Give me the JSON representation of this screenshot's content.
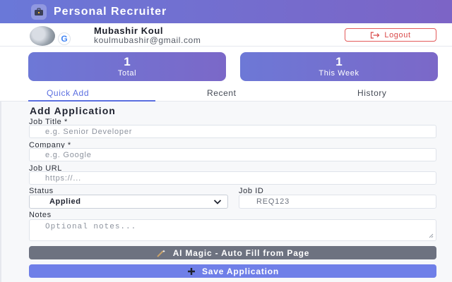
{
  "header": {
    "title": "Personal Recruiter",
    "logo_icon": "briefcase-icon"
  },
  "user": {
    "name": "Mubashir Koul",
    "email": "koulmubashir@gmail.com",
    "logout_label": "Logout"
  },
  "stats": [
    {
      "value": "1",
      "label": "Total"
    },
    {
      "value": "1",
      "label": "This Week"
    }
  ],
  "tabs": [
    {
      "label": "Quick Add",
      "active": true
    },
    {
      "label": "Recent",
      "active": false
    },
    {
      "label": "History",
      "active": false
    }
  ],
  "form": {
    "title": "Add Application",
    "job_title": {
      "label": "Job Title *",
      "placeholder": "e.g. Senior Developer"
    },
    "company": {
      "label": "Company *",
      "placeholder": "e.g. Google"
    },
    "job_url": {
      "label": "Job URL",
      "placeholder": "https://..."
    },
    "status": {
      "label": "Status",
      "value": "Applied"
    },
    "job_id": {
      "label": "Job ID",
      "value": "REQ123"
    },
    "notes": {
      "label": "Notes",
      "placeholder": "Optional notes..."
    },
    "ai_button": "AI Magic - Auto Fill from Page",
    "save_button": "Save Application"
  },
  "colors": {
    "accent": "#5b6fe0",
    "header_start": "#6a78d8",
    "header_end": "#7c64c6",
    "danger": "#d94848"
  }
}
